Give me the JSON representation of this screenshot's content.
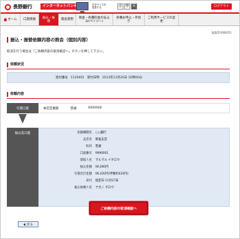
{
  "header": {
    "bank_name": "長野銀行",
    "service_badge": "インターネットバンキング",
    "font_size_label": "文字サイズを変更する",
    "font_sizes": [
      "小",
      "中",
      "大"
    ],
    "logout_label": "ログアウト"
  },
  "nav": {
    "items": [
      {
        "label": "ホーム",
        "icon": "home-icon"
      },
      {
        "label": "口座情報"
      },
      {
        "label": "振込・振替"
      },
      {
        "label": "資産運用"
      },
      {
        "label": "税金・各種料金の払込み(ペイジー)"
      },
      {
        "label": "各種お申込・手続き"
      },
      {
        "label": "ご利用サービスの変更"
      }
    ]
  },
  "screen_id": "画面ID:BNS051",
  "page_title": "振込・振替依頼内容の照会（個別内容）",
  "instruction": "取消を行う場合は「ご依頼内容の取消確認へ」ボタンを押して下さい。",
  "sections": {
    "status_heading": "依頼状況",
    "content_heading": "依頼内容"
  },
  "status": {
    "receipt_label": "受付番号",
    "receipt_number": "1120001",
    "date_label": "受付日時",
    "date_value": "2013年11月20日 10時00分"
  },
  "source": {
    "tag": "引落口座",
    "branch": "本店営業部",
    "type": "普通",
    "number": "0000000"
  },
  "destination": {
    "tag": "振込先口座",
    "rows": [
      {
        "label": "金融機関名",
        "value": "○○銀行"
      },
      {
        "label": "支店名",
        "value": "新宿支店"
      },
      {
        "label": "科目",
        "value": "普通"
      },
      {
        "label": "口座番号",
        "value": "9990001"
      },
      {
        "label": "受取人名",
        "value": "マルマル イチロウ"
      },
      {
        "label": "振込金額",
        "value": "90,000円"
      },
      {
        "label": "引落合計金額",
        "value": "90,420円(手数料420円)"
      },
      {
        "label": "日付",
        "value": "指定日 11月27日"
      },
      {
        "label": "振込依頼人名",
        "value": "ナガノ タロウ"
      }
    ]
  },
  "buttons": {
    "confirm_cancel": "ご依頼内容の取消確認へ",
    "back": "戻る"
  },
  "colors": {
    "brand_red": "#d8161e",
    "panel_blue": "#e1eaf4",
    "tag_gray": "#555555"
  }
}
